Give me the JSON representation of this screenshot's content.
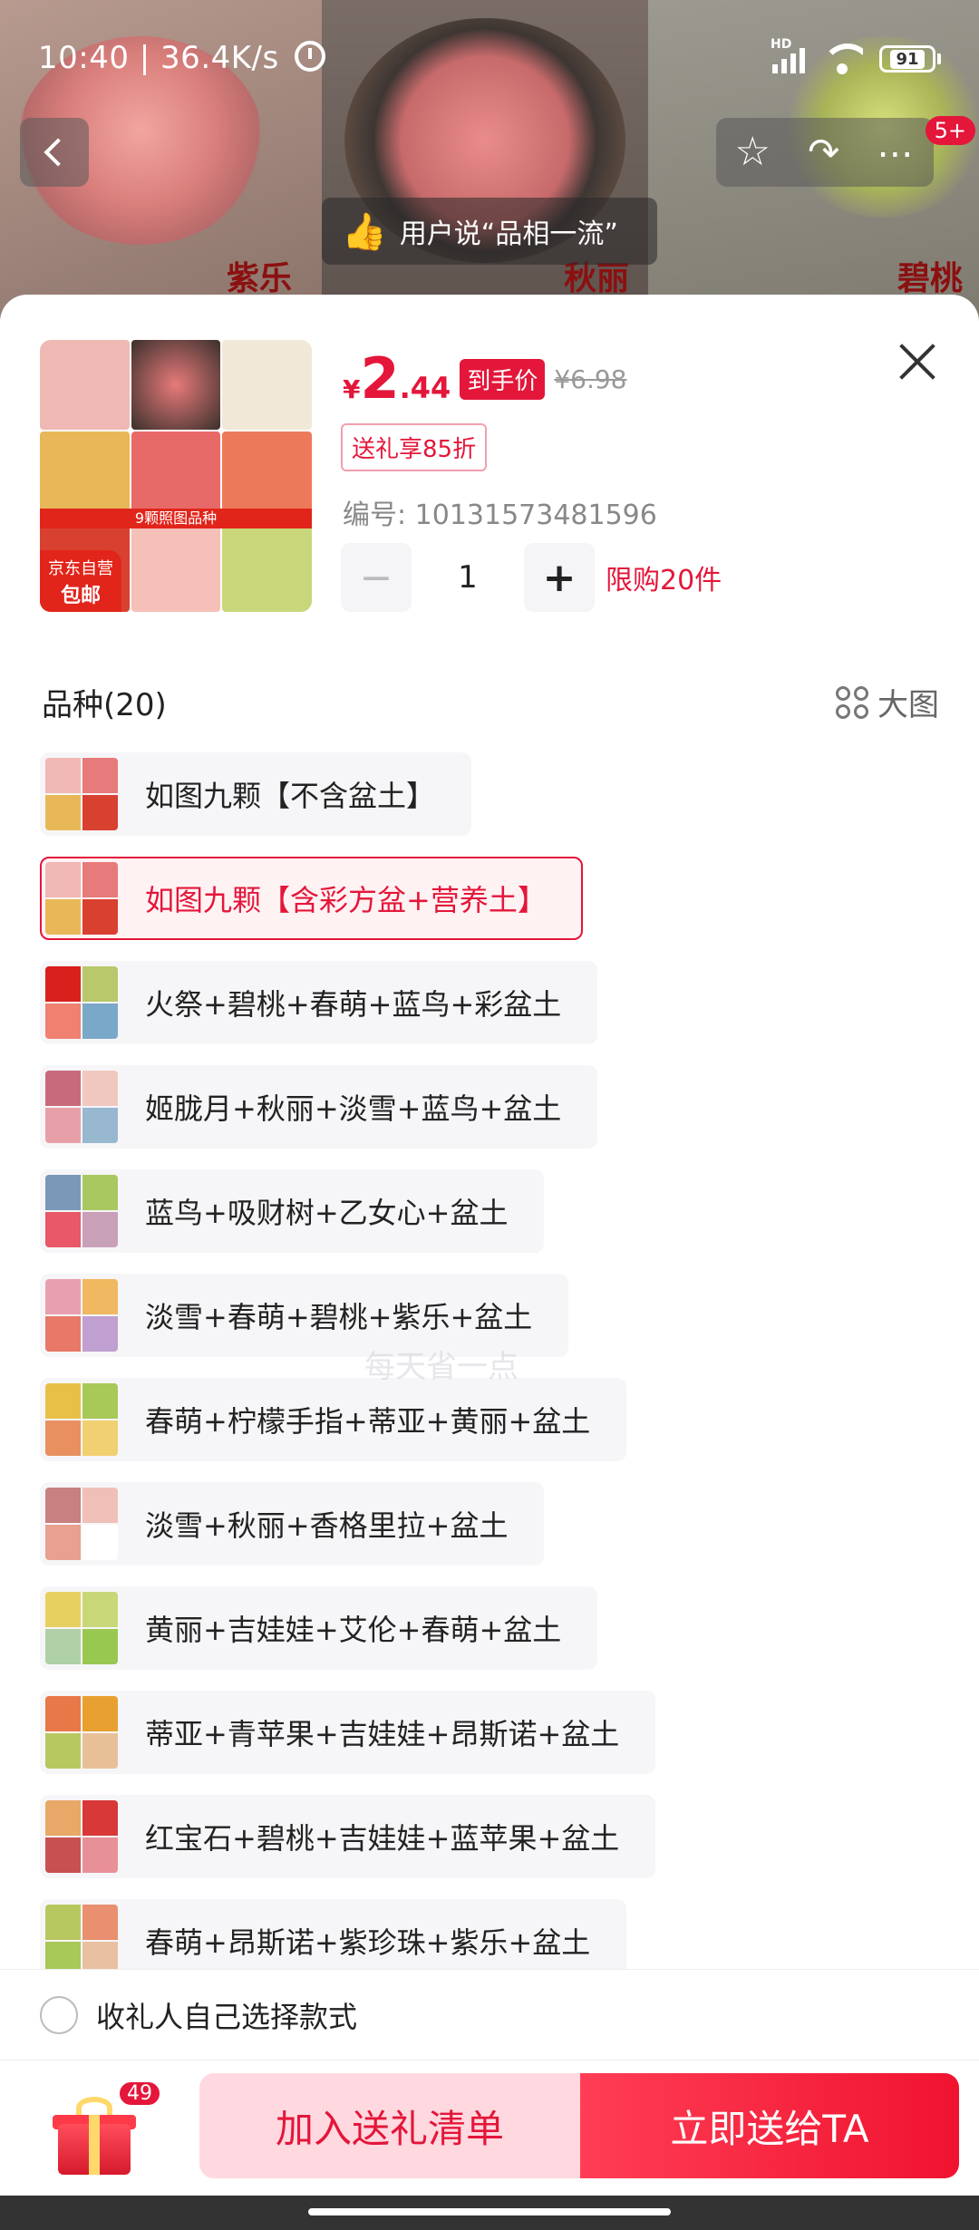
{
  "status_bar": {
    "time_speed": "10:40 | 36.4K/s",
    "network_label": "HD",
    "battery": "91"
  },
  "top_nav": {
    "badge_count": "5+"
  },
  "background_image": {
    "captions": [
      "紫乐",
      "秋丽",
      "碧桃"
    ]
  },
  "praise": {
    "text": "用户说“品相一流”"
  },
  "product": {
    "thumb_banner": "9颗照图品种",
    "jd_badge_line1": "京东自营",
    "jd_badge_line2": "包邮",
    "price_symbol": "¥",
    "price_int": "2",
    "price_dec": ".44",
    "price_tag": "到手价",
    "original_price": "¥6.98",
    "gift_discount": "送礼享85折",
    "sku_number": "编号: 10131573481596",
    "quantity": "1",
    "minus": "−",
    "plus": "+",
    "limit": "限购20件"
  },
  "variants": {
    "header": "品种(20)",
    "big_image_label": "大图",
    "items": [
      {
        "label": "如图九颗【不含盆土】",
        "selected": false
      },
      {
        "label": "如图九颗【含彩方盆+营养土】",
        "selected": true
      },
      {
        "label": "火祭+碧桃+春萌+蓝鸟+彩盆土",
        "selected": false
      },
      {
        "label": "姬胧月+秋丽+淡雪+蓝鸟+盆土",
        "selected": false
      },
      {
        "label": "蓝鸟+吸财树+乙女心+盆土",
        "selected": false
      },
      {
        "label": "淡雪+春萌+碧桃+紫乐+盆土",
        "selected": false
      },
      {
        "label": "春萌+柠檬手指+蒂亚+黄丽+盆土",
        "selected": false
      },
      {
        "label": "淡雪+秋丽+香格里拉+盆土",
        "selected": false
      },
      {
        "label": "黄丽+吉娃娃+艾伦+春萌+盆土",
        "selected": false
      },
      {
        "label": "蒂亚+青苹果+吉娃娃+昂斯诺+盆土",
        "selected": false
      },
      {
        "label": "红宝石+碧桃+吉娃娃+蓝苹果+盆土",
        "selected": false
      },
      {
        "label": "春萌+昂斯诺+紫珍珠+紫乐+盆土",
        "selected": false
      }
    ]
  },
  "watermark": "每天省一点",
  "self_choose": {
    "label": "收礼人自己选择款式"
  },
  "bottom_bar": {
    "gift_count": "49",
    "add_button": "加入送礼清单",
    "send_button": "立即送给TA"
  },
  "colors": {
    "accent": "#e4163a",
    "selected_bg": "#fff2f3",
    "chip_bg": "#f6f6f8"
  }
}
